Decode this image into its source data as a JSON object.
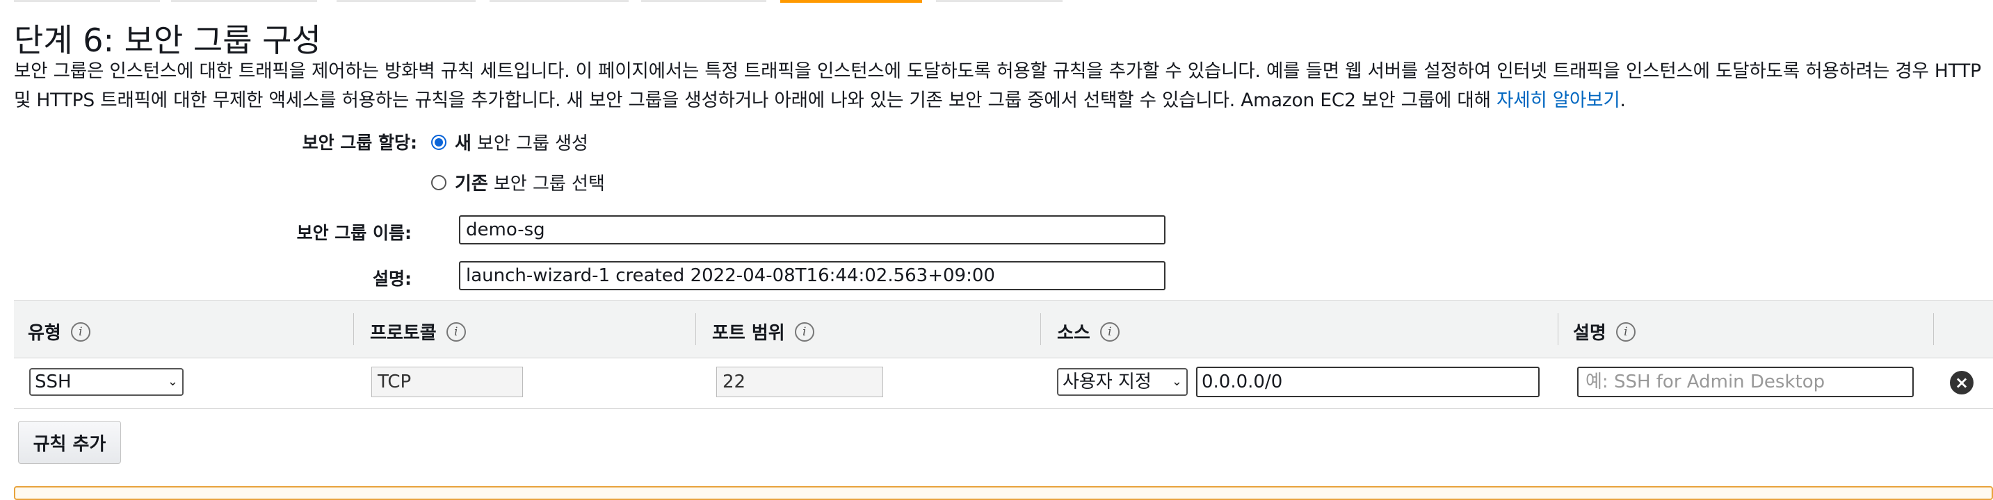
{
  "colors": {
    "accent": "#ff9900",
    "link": "#0066c0",
    "radio": "#0a64d8",
    "warning_border": "#e8a33c"
  },
  "page": {
    "title": "단계 6: 보안 그룹 구성",
    "description": "보안 그룹은 인스턴스에 대한 트래픽을 제어하는 방화벽 규칙 세트입니다. 이 페이지에서는 특정 트래픽을 인스턴스에 도달하도록 허용할 규칙을 추가할 수 있습니다. 예를 들면 웹 서버를 설정하여 인터넷 트래픽을 인스턴스에 도달하도록 허용하려는 경우 HTTP 및 HTTPS 트래픽에 대한 무제한 액세스를 허용하는 규칙을 추가합니다. 새 보안 그룹을 생성하거나 아래에 나와 있는 기존 보안 그룹 중에서 선택할 수 있습니다. Amazon EC2 보안 그룹에 대해",
    "learn_more_link": "자세히 알아보기",
    "learn_more_suffix": "."
  },
  "form": {
    "assign_label": "보안 그룹 할당:",
    "new_option_bold": "새",
    "new_option_text": "보안 그룹 생성",
    "new_option_selected": true,
    "existing_option_bold": "기존",
    "existing_option_text": "보안 그룹 선택",
    "name_label": "보안 그룹 이름:",
    "name_value": "demo-sg",
    "desc_label": "설명:",
    "desc_value": "launch-wizard-1 created 2022-04-08T16:44:02.563+09:00"
  },
  "rules_table": {
    "columns": [
      "유형",
      "프로토콜",
      "포트 범위",
      "소스",
      "설명"
    ],
    "rows": [
      {
        "type": "SSH",
        "protocol": "TCP",
        "port_range": "22",
        "source_mode": "사용자 지정",
        "source_cidr": "0.0.0.0/0",
        "description_placeholder": "예: SSH for Admin Desktop"
      }
    ],
    "add_rule_label": "규칙 추가"
  },
  "icons": {
    "info": "info-icon",
    "delete": "delete-rule-icon",
    "dropdown": "chevron-down-icon"
  }
}
